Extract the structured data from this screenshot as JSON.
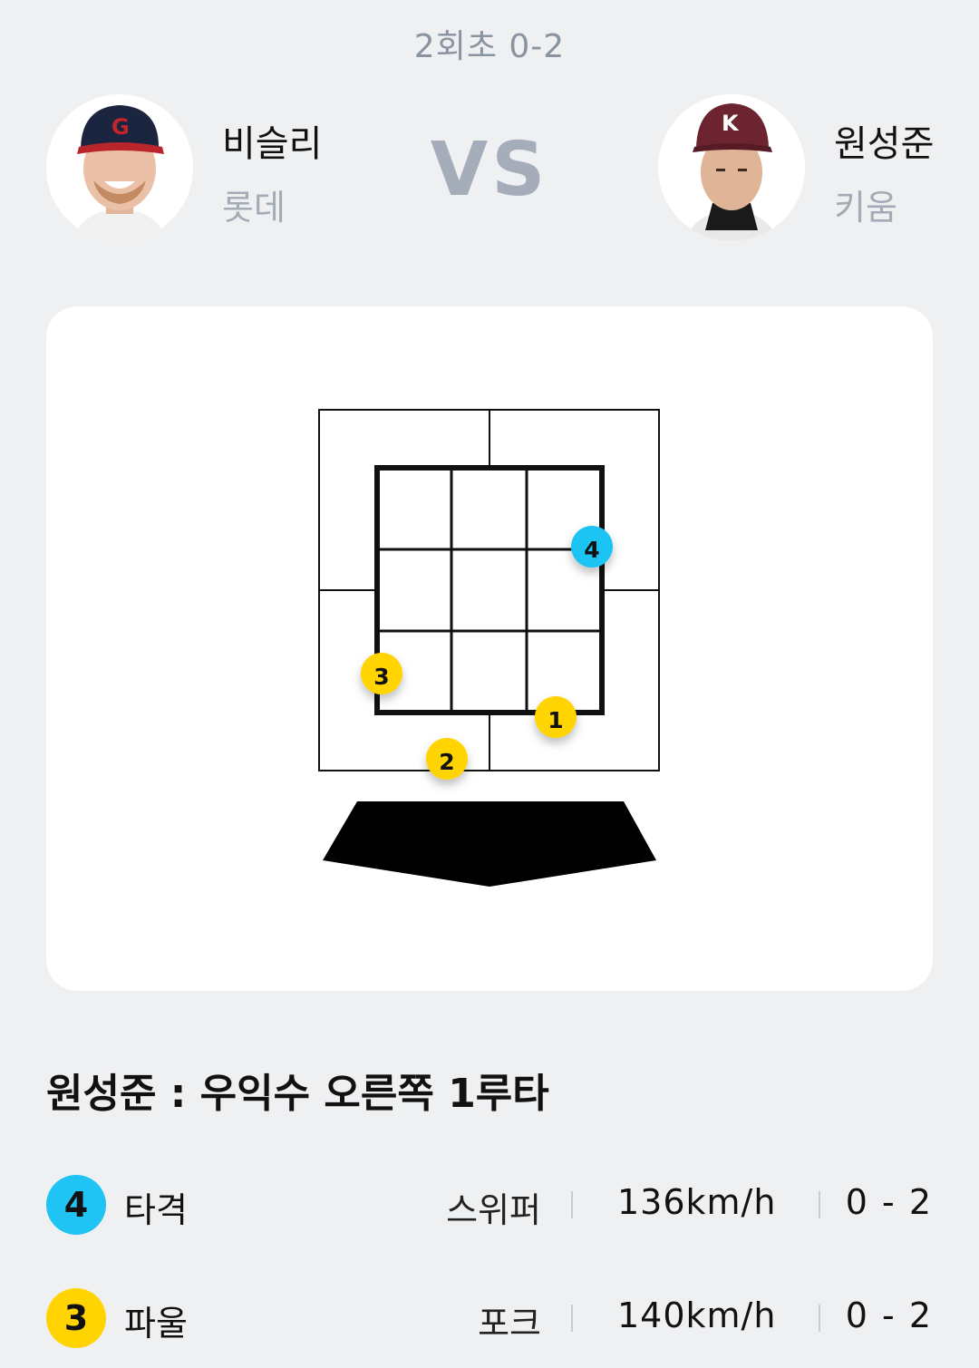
{
  "header": {
    "inning_score": "2회초 0-2",
    "vs_label": "VS"
  },
  "pitcher": {
    "name": "비슬리",
    "team": "롯데",
    "cap_letter": "G"
  },
  "batter": {
    "name": "원성준",
    "team": "키움",
    "cap_letter": "K"
  },
  "strike_zone": {
    "pitches": [
      {
        "number": "1",
        "result": "foul"
      },
      {
        "number": "2",
        "result": "foul"
      },
      {
        "number": "3",
        "result": "foul"
      },
      {
        "number": "4",
        "result": "hit"
      }
    ]
  },
  "at_bat_result": "원성준 : 우익수 오른쪽 1루타",
  "pitch_log": [
    {
      "number": "4",
      "type": "타격",
      "pitch": "스위퍼",
      "speed": "136km/h",
      "count": "0 - 2",
      "color": "#1fc4f4"
    },
    {
      "number": "3",
      "type": "파울",
      "pitch": "포크",
      "speed": "140km/h",
      "count": "0 - 2",
      "color": "#ffd400"
    }
  ],
  "colors": {
    "hit": "#1fc4f4",
    "foul": "#ffd400",
    "background": "#eff0f2",
    "muted": "#a4adb9"
  }
}
